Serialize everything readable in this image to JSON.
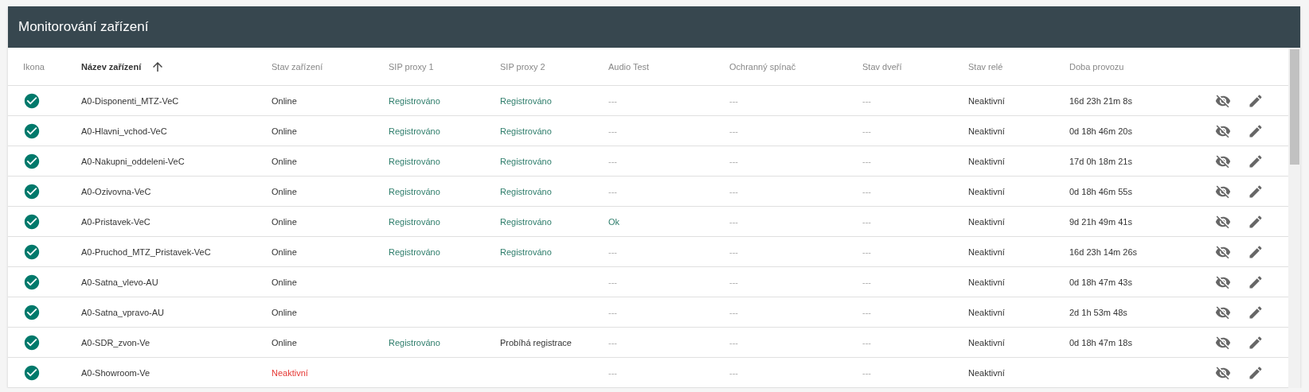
{
  "title": "Monitorování zařízení",
  "columns": [
    {
      "label": "Ikona",
      "sorted": false
    },
    {
      "label": "Název zařízení",
      "sorted": true
    },
    {
      "label": "Stav zařízení",
      "sorted": false
    },
    {
      "label": "SIP proxy 1",
      "sorted": false
    },
    {
      "label": "SIP proxy 2",
      "sorted": false
    },
    {
      "label": "Audio Test",
      "sorted": false
    },
    {
      "label": "Ochranný spínač",
      "sorted": false
    },
    {
      "label": "Stav dveří",
      "sorted": false
    },
    {
      "label": "Stav relé",
      "sorted": false
    },
    {
      "label": "Doba provozu",
      "sorted": false
    }
  ],
  "rows": [
    {
      "name": "A0-Disponenti_MTZ-VeC",
      "state": {
        "text": "Online",
        "kind": "normal"
      },
      "sip1": {
        "text": "Registrováno",
        "kind": "ok"
      },
      "sip2": {
        "text": "Registrováno",
        "kind": "ok"
      },
      "audio": {
        "text": "---",
        "kind": "muted"
      },
      "switch": "---",
      "door": "---",
      "relay": "Neaktivní",
      "uptime": "16d 23h 21m 8s"
    },
    {
      "name": "A0-Hlavni_vchod-VeC",
      "state": {
        "text": "Online",
        "kind": "normal"
      },
      "sip1": {
        "text": "Registrováno",
        "kind": "ok"
      },
      "sip2": {
        "text": "Registrováno",
        "kind": "ok"
      },
      "audio": {
        "text": "---",
        "kind": "muted"
      },
      "switch": "---",
      "door": "---",
      "relay": "Neaktivní",
      "uptime": "0d 18h 46m 20s"
    },
    {
      "name": "A0-Nakupni_oddeleni-VeC",
      "state": {
        "text": "Online",
        "kind": "normal"
      },
      "sip1": {
        "text": "Registrováno",
        "kind": "ok"
      },
      "sip2": {
        "text": "Registrováno",
        "kind": "ok"
      },
      "audio": {
        "text": "---",
        "kind": "muted"
      },
      "switch": "---",
      "door": "---",
      "relay": "Neaktivní",
      "uptime": "17d 0h 18m 21s"
    },
    {
      "name": "A0-Ozivovna-VeC",
      "state": {
        "text": "Online",
        "kind": "normal"
      },
      "sip1": {
        "text": "Registrováno",
        "kind": "ok"
      },
      "sip2": {
        "text": "Registrováno",
        "kind": "ok"
      },
      "audio": {
        "text": "---",
        "kind": "muted"
      },
      "switch": "---",
      "door": "---",
      "relay": "Neaktivní",
      "uptime": "0d 18h 46m 55s"
    },
    {
      "name": "A0-Pristavek-VeC",
      "state": {
        "text": "Online",
        "kind": "normal"
      },
      "sip1": {
        "text": "Registrováno",
        "kind": "ok"
      },
      "sip2": {
        "text": "Registrováno",
        "kind": "ok"
      },
      "audio": {
        "text": "Ok",
        "kind": "ok"
      },
      "switch": "---",
      "door": "---",
      "relay": "Neaktivní",
      "uptime": "9d 21h 49m 41s"
    },
    {
      "name": "A0-Pruchod_MTZ_Pristavek-VeC",
      "state": {
        "text": "Online",
        "kind": "normal"
      },
      "sip1": {
        "text": "Registrováno",
        "kind": "ok"
      },
      "sip2": {
        "text": "Registrováno",
        "kind": "ok"
      },
      "audio": {
        "text": "---",
        "kind": "muted"
      },
      "switch": "---",
      "door": "---",
      "relay": "Neaktivní",
      "uptime": "16d 23h 14m 26s"
    },
    {
      "name": "A0-Satna_vlevo-AU",
      "state": {
        "text": "Online",
        "kind": "normal"
      },
      "audio": {
        "text": "---",
        "kind": "muted"
      },
      "switch": "---",
      "door": "---",
      "relay": "Neaktivní",
      "uptime": "0d 18h 47m 43s"
    },
    {
      "name": "A0-Satna_vpravo-AU",
      "state": {
        "text": "Online",
        "kind": "normal"
      },
      "audio": {
        "text": "---",
        "kind": "muted"
      },
      "switch": "---",
      "door": "---",
      "relay": "Neaktivní",
      "uptime": "2d 1h 53m 48s"
    },
    {
      "name": "A0-SDR_zvon-Ve",
      "state": {
        "text": "Online",
        "kind": "normal"
      },
      "sip1": {
        "text": "Registrováno",
        "kind": "ok"
      },
      "sip2": {
        "text": "Probíhá registrace",
        "kind": "normal"
      },
      "audio": {
        "text": "---",
        "kind": "muted"
      },
      "switch": "---",
      "door": "---",
      "relay": "Neaktivní",
      "uptime": "0d 18h 47m 18s"
    },
    {
      "name": "A0-Showroom-Ve",
      "state": {
        "text": "Neaktivní",
        "kind": "error"
      },
      "audio": {
        "text": "---",
        "kind": "muted"
      },
      "switch": "---",
      "door": "---",
      "relay": "Neaktivní"
    }
  ]
}
